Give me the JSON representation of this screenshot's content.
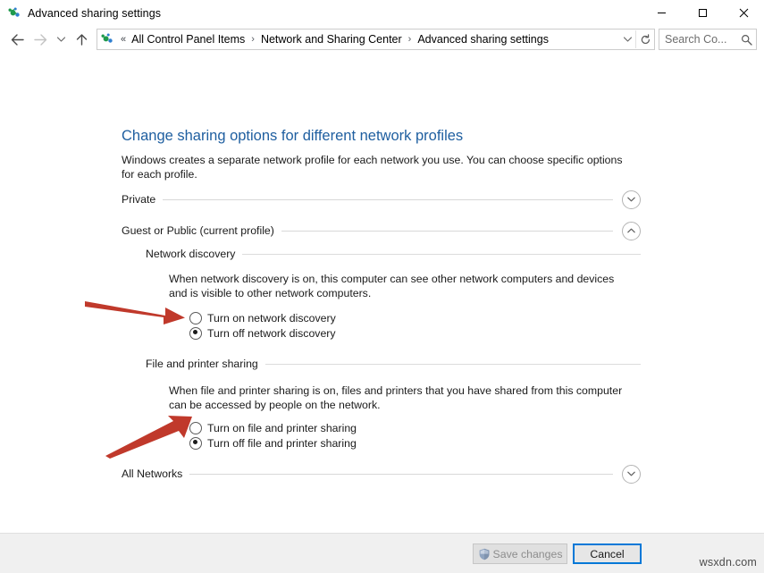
{
  "window": {
    "title": "Advanced sharing settings",
    "icon": "network-sharing-icon",
    "minimize_label": "Minimize",
    "maximize_label": "Maximize",
    "close_label": "Close"
  },
  "nav": {
    "back_label": "Back",
    "forward_label": "Forward",
    "recent_label": "Recent locations",
    "up_label": "Up",
    "refresh_label": "Refresh",
    "dropdown_label": "Previous locations",
    "breadcrumb_overflow": "«",
    "breadcrumbs": [
      "All Control Panel Items",
      "Network and Sharing Center",
      "Advanced sharing settings"
    ],
    "separator": "›"
  },
  "search": {
    "value": "",
    "placeholder": "Search Co...",
    "icon": "search-icon"
  },
  "main": {
    "heading": "Change sharing options for different network profiles",
    "description": "Windows creates a separate network profile for each network you use. You can choose specific options for each profile.",
    "profiles": [
      {
        "label": "Private",
        "expanded": false,
        "chevron": "chevron-down-icon"
      },
      {
        "label": "Guest or Public (current profile)",
        "expanded": true,
        "chevron": "chevron-up-icon"
      },
      {
        "label": "All Networks",
        "expanded": false,
        "chevron": "chevron-down-icon"
      }
    ],
    "sections": [
      {
        "title": "Network discovery",
        "description": "When network discovery is on, this computer can see other network computers and devices and is visible to other network computers.",
        "options": [
          {
            "label": "Turn on network discovery",
            "selected": false
          },
          {
            "label": "Turn off network discovery",
            "selected": true
          }
        ]
      },
      {
        "title": "File and printer sharing",
        "description": "When file and printer sharing is on, files and printers that you have shared from this computer can be accessed by people on the network.",
        "options": [
          {
            "label": "Turn on file and printer sharing",
            "selected": false
          },
          {
            "label": "Turn off file and printer sharing",
            "selected": true
          }
        ]
      }
    ]
  },
  "annotations": {
    "arrow_color": "#c0392b",
    "arrow_1_name": "red-arrow-network-discovery",
    "arrow_2_name": "red-arrow-file-printer-sharing"
  },
  "footer": {
    "save_label": "Save changes",
    "save_enabled": false,
    "save_icon": "uac-shield-icon",
    "cancel_label": "Cancel"
  },
  "watermark": {
    "text": "wsxdn.com"
  },
  "colors": {
    "heading": "#1f5fa0",
    "focus_border": "#0078d7",
    "arrow": "#c0392b"
  }
}
